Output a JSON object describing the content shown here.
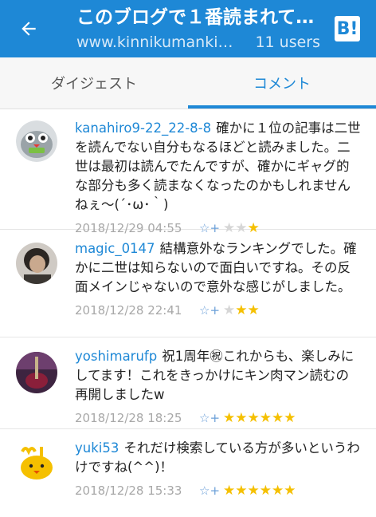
{
  "header": {
    "title": "このブログで１番読まれて…",
    "url": "www.kinnikumankin...",
    "users": "11 users",
    "logo_text": "B!"
  },
  "tabs": [
    {
      "label": "ダイジェスト",
      "active": false
    },
    {
      "label": "コメント",
      "active": true
    }
  ],
  "comments": [
    {
      "user": "kanahiro9-22_22-8-8",
      "text": "確かに１位の記事は二世を読んでない自分もなるほどと読みました。二世は最初は読んでたんですが、確かにギャグ的な部分も多く読まなくなったのかもしれませんねぇ〜(´･ω･｀)",
      "date": "2018/12/29 04:55",
      "add_star": "☆+",
      "stars": "★",
      "grey_stars": "★★"
    },
    {
      "user": "magic_0147",
      "text": "結構意外なランキングでした。確かに二世は知らないので面白いですね。その反面メインじゃないので意外な感じがしました。",
      "date": "2018/12/28 22:41",
      "add_star": "☆+",
      "stars": "★★",
      "grey_stars": "★"
    },
    {
      "user": "yoshimarufp",
      "text": "祝1周年㊗これからも、楽しみにしてます！これをきっかけにキン肉マン読むの再開しましたw",
      "date": "2018/12/28 18:25",
      "add_star": "☆+",
      "stars": "★★★★★★",
      "grey_stars": ""
    },
    {
      "user": "yuki53",
      "text": "それだけ検索している方が多いというわけですね(^^)！",
      "date": "2018/12/28 15:33",
      "add_star": "☆+",
      "stars": "★★★★★★",
      "grey_stars": ""
    }
  ],
  "colors": {
    "brand": "#1e88d6",
    "star": "#f5c000"
  }
}
